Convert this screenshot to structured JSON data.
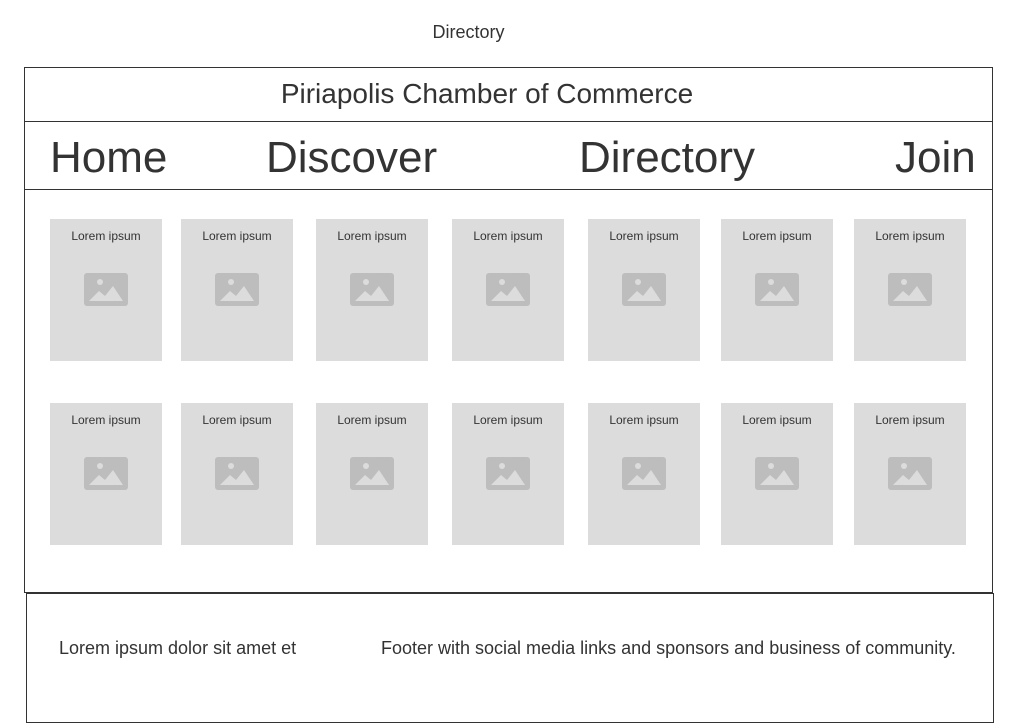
{
  "page_heading": "Directory",
  "site_title": "Piriapolis Chamber of Commerce",
  "nav": {
    "home": "Home",
    "discover": "Discover",
    "directory": "Directory",
    "join": "Join"
  },
  "cards": {
    "row1": [
      "Lorem ipsum",
      "Lorem ipsum",
      "Lorem ipsum",
      "Lorem ipsum",
      "Lorem ipsum",
      "Lorem ipsum",
      "Lorem ipsum"
    ],
    "row2": [
      "Lorem ipsum",
      "Lorem ipsum",
      "Lorem ipsum",
      "Lorem ipsum",
      "Lorem ipsum",
      "Lorem ipsum",
      "Lorem ipsum"
    ],
    "icon": "image-placeholder-icon"
  },
  "footer": {
    "left": "Lorem ipsum dolor sit amet et",
    "right": "Footer with social media links and sponsors and business of community."
  },
  "colors": {
    "card_background": "#dcdcdc",
    "icon": "#bdbdbd",
    "text": "#333333",
    "border": "#333333"
  }
}
